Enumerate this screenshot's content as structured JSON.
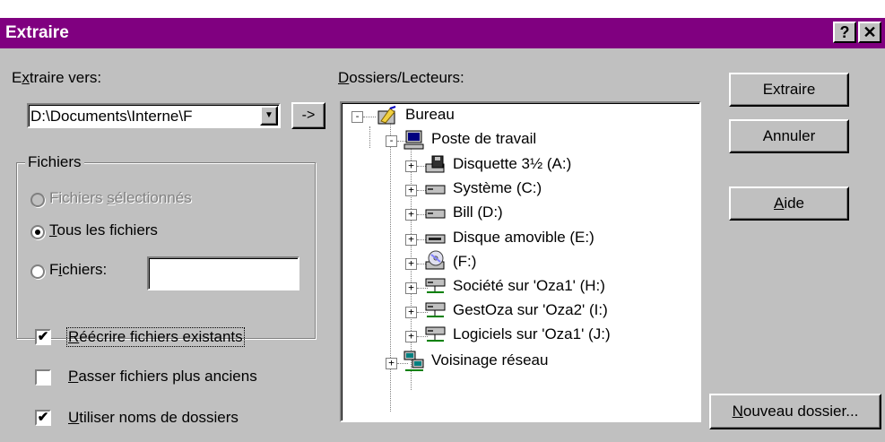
{
  "window": {
    "title": "Extraire",
    "help_button": "?",
    "close_button": "✕"
  },
  "extract_to": {
    "label_pre": "E",
    "label_u": "x",
    "label_post": "traire vers:",
    "value": "D:\\Documents\\Interne\\F",
    "browse_button": "->"
  },
  "files_group": {
    "title": "Fichiers",
    "options": [
      {
        "pre": "Fichiers ",
        "u": "s",
        "post": "électionnés",
        "selected": false,
        "disabled": true
      },
      {
        "pre": "",
        "u": "T",
        "post": "ous les fichiers",
        "selected": true,
        "disabled": false
      },
      {
        "pre": "F",
        "u": "i",
        "post": "chiers:",
        "selected": false,
        "disabled": false
      }
    ],
    "filter_value": ""
  },
  "checkboxes": [
    {
      "u": "R",
      "post": "éécrire fichiers existants",
      "checked": true
    },
    {
      "u": "P",
      "post": "asser fichiers plus anciens",
      "checked": false
    },
    {
      "u": "U",
      "post": "tiliser noms de dossiers",
      "checked": true
    }
  ],
  "folders": {
    "label_u": "D",
    "label_post": "ossiers/Lecteurs:",
    "tree": [
      {
        "label": "Bureau",
        "icon": "desktop-icon",
        "expander": "-"
      },
      {
        "label": "Poste de travail",
        "icon": "computer-icon",
        "expander": "-"
      },
      {
        "label": "Disquette 3½ (A:)",
        "icon": "floppy-drive-icon",
        "expander": "+"
      },
      {
        "label": "Système (C:)",
        "icon": "hard-drive-icon",
        "expander": "+"
      },
      {
        "label": "Bill (D:)",
        "icon": "hard-drive-icon",
        "expander": "+"
      },
      {
        "label": "Disque amovible (E:)",
        "icon": "removable-drive-icon",
        "expander": "+"
      },
      {
        "label": " (F:)",
        "icon": "cd-drive-icon",
        "expander": "+"
      },
      {
        "label": "Société sur 'Oza1' (H:)",
        "icon": "network-drive-icon",
        "expander": "+"
      },
      {
        "label": "GestOza sur 'Oza2' (I:)",
        "icon": "network-drive-icon",
        "expander": "+"
      },
      {
        "label": "Logiciels sur 'Oza1' (J:)",
        "icon": "network-drive-icon",
        "expander": "+"
      },
      {
        "label": "Voisinage réseau",
        "icon": "network-neighborhood-icon",
        "expander": "+"
      }
    ]
  },
  "buttons": {
    "extract": "Extraire",
    "cancel": "Annuler",
    "help_u": "A",
    "help_post": "ide",
    "new_folder_u": "N",
    "new_folder_post": "ouveau dossier..."
  }
}
